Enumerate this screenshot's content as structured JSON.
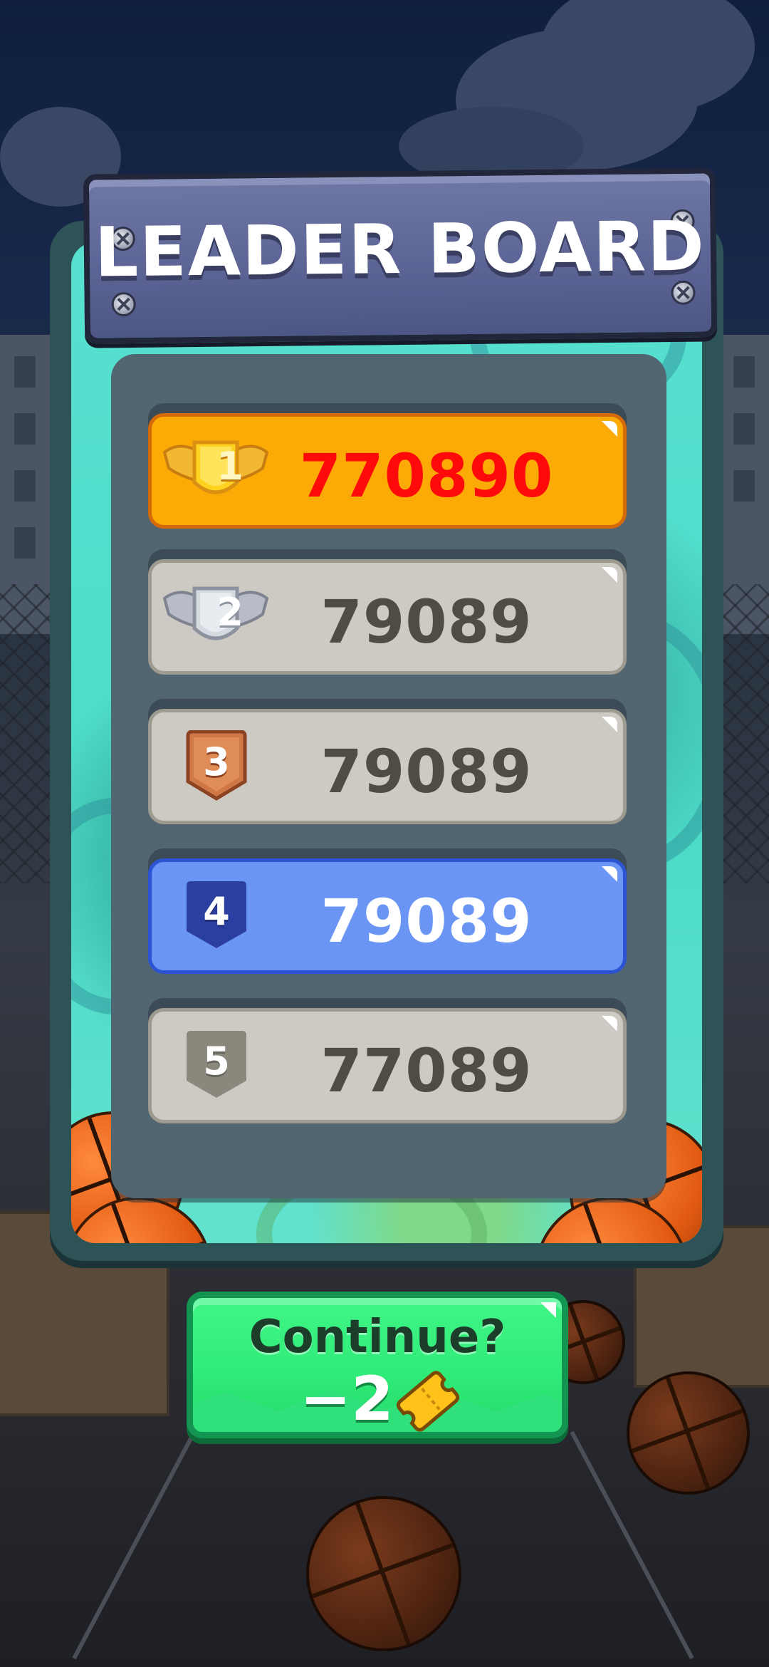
{
  "title": "LEADER BOARD",
  "leaderboard": [
    {
      "rank": "1",
      "score": "770890",
      "style": "gold",
      "badge": "winged-gold"
    },
    {
      "rank": "2",
      "score": "79089",
      "style": "silver",
      "badge": "winged-silver"
    },
    {
      "rank": "3",
      "score": "79089",
      "style": "silver",
      "badge": "bronze"
    },
    {
      "rank": "4",
      "score": "79089",
      "style": "blue",
      "badge": "navy"
    },
    {
      "rank": "5",
      "score": "77089",
      "style": "silver",
      "badge": "gray"
    }
  ],
  "continue": {
    "label": "Continue?",
    "cost": "−2",
    "cost_icon": "ticket-icon"
  },
  "colors": {
    "first_place_score": "#ff0a0a",
    "own_rank_row": "#6b95f5",
    "gold_row": "#fcaa05",
    "continue_button": "#30ec79"
  }
}
